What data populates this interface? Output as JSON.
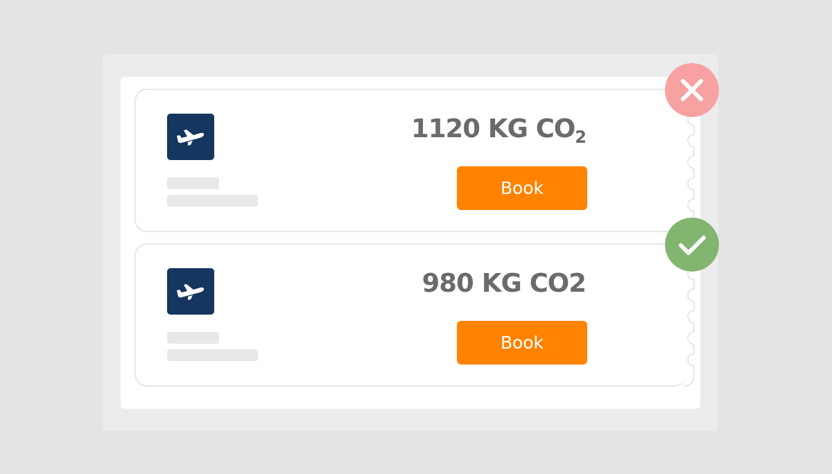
{
  "tickets": [
    {
      "emission": "1120 KG CO$_{2}$",
      "button": "Book",
      "kind": "rejected"
    },
    {
      "emission": "980 KG CO2",
      "button": "Book",
      "kind": "approved"
    }
  ]
}
